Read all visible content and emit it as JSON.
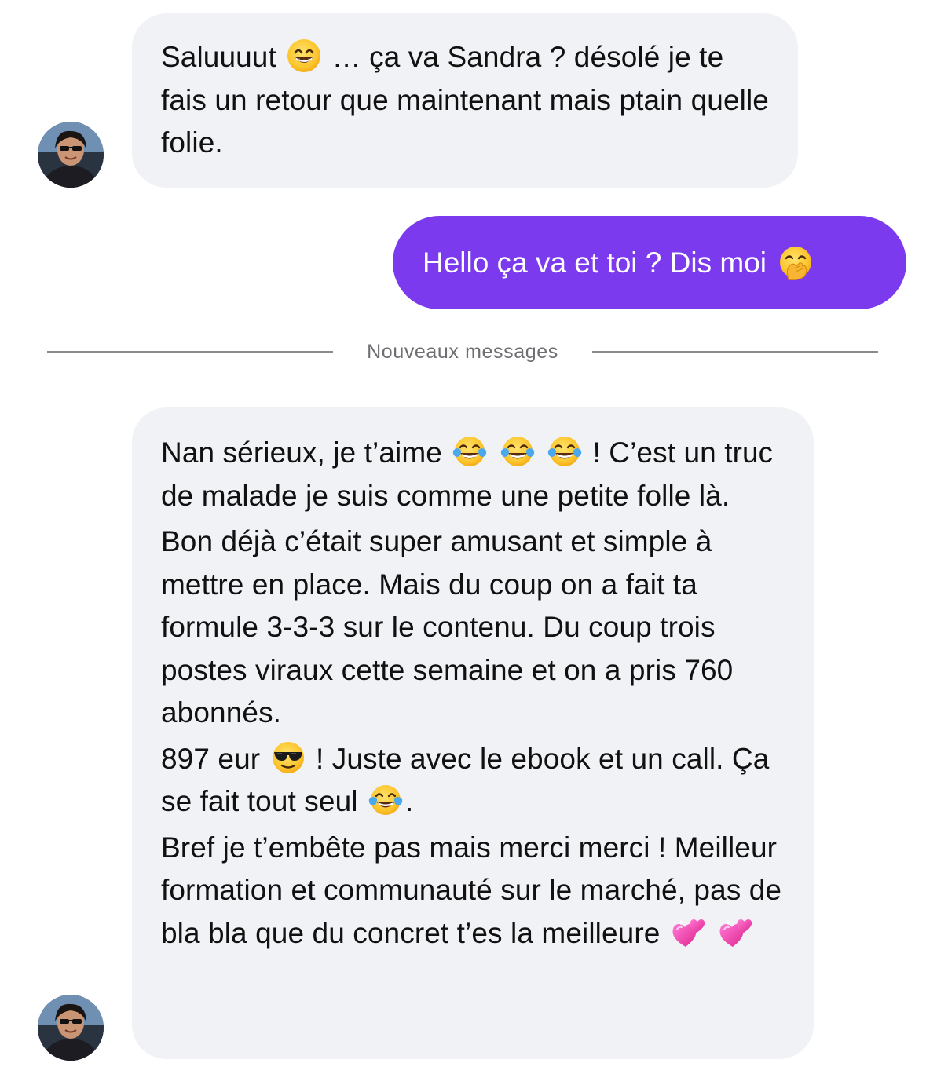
{
  "divider": {
    "label": "Nouveaux messages"
  },
  "colors": {
    "incoming_bubble": "#f1f2f6",
    "outgoing_bubble": "#7c3aee",
    "divider_line": "#8a8a8e"
  },
  "messages": [
    {
      "sender": "contact",
      "avatar": "contact-avatar",
      "segments": [
        "Saluuuut",
        "grinning-face-icon",
        "… ça va Sandra ? désolé je te fais un retour que maintenant mais ptain quelle folie."
      ]
    },
    {
      "sender": "me",
      "segments": [
        "Hello ça va et toi ? Dis moi",
        "face-with-hand-over-mouth-icon"
      ]
    },
    {
      "sender": "contact",
      "avatar": "contact-avatar",
      "paragraphs": [
        {
          "pre": "Nan sérieux, je t’aime",
          "emojis": [
            "tears-of-joy-icon",
            "tears-of-joy-icon",
            "tears-of-joy-icon"
          ],
          "post": "! C’est un truc de malade je suis comme une petite folle là."
        },
        {
          "text": "Bon déjà c’était super amusant et simple à mettre en place. Mais du coup on a fait ta formule 3-3-3 sur le contenu. Du coup trois postes viraux cette semaine et on a pris 760 abonnés."
        },
        {
          "pre": "897 eur",
          "emoji": "sunglasses-face-icon",
          "mid": "! Juste avec le ebook et un call. Ça se fait tout seul",
          "emoji2": "tears-of-joy-icon",
          "post": "."
        },
        {
          "pre": "Bref je t’embête pas mais merci merci ! Meilleur formation et communauté sur le marché, pas de bla bla que du concret t’es la meilleure",
          "emojis": [
            "two-hearts-icon",
            "two-hearts-icon"
          ]
        }
      ]
    }
  ]
}
